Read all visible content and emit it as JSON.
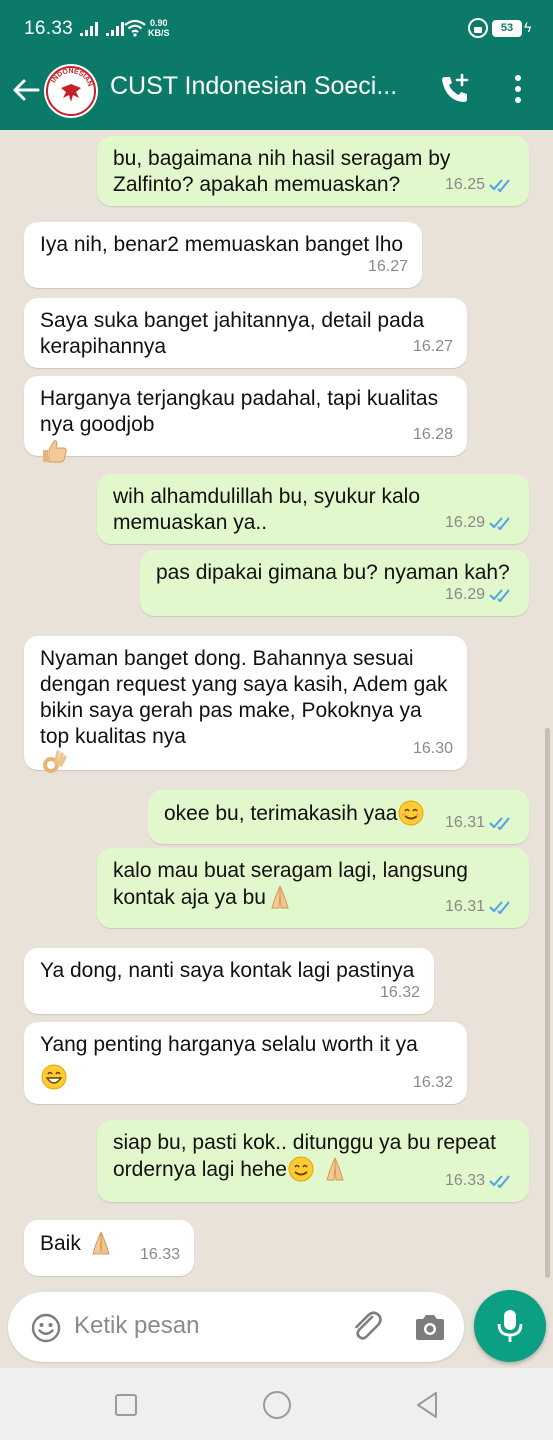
{
  "status_bar": {
    "time": "16.33",
    "net_speed_value": "0.90",
    "net_speed_unit": "KB/S",
    "battery": "53"
  },
  "header": {
    "avatar_text": "INDONESIAN",
    "title": "CUST Indonesian Soeci..."
  },
  "messages": [
    {
      "dir": "out",
      "text": "bu, bagaimana nih hasil seragam by\nZalfinto? apakah memuaskan?",
      "time": "16.25",
      "read": true
    },
    {
      "dir": "in",
      "text": "Iya nih, benar2 memuaskan banget lho",
      "time": "16.27"
    },
    {
      "dir": "in",
      "text": "Saya suka banget jahitannya, detail pada\nkerapihannya",
      "time": "16.27"
    },
    {
      "dir": "in",
      "text": "Harganya terjangkau padahal, tapi kualitas\nnya goodjob",
      "emoji": "thumbs-up",
      "time": "16.28"
    },
    {
      "dir": "out",
      "text": "wih alhamdulillah bu, syukur kalo\nmemuaskan ya..",
      "time": "16.29",
      "read": true
    },
    {
      "dir": "out",
      "text": "pas dipakai gimana bu? nyaman kah?",
      "time": "16.29",
      "read": true
    },
    {
      "dir": "in",
      "text": "Nyaman banget dong. Bahannya sesuai\ndengan request yang saya kasih, Adem gak\nbikin saya gerah pas make, Pokoknya ya\ntop kualitas nya",
      "emoji": "ok-hand",
      "time": "16.30"
    },
    {
      "dir": "out",
      "text": "okee bu, terimakasih yaa",
      "emoji": "smile",
      "time": "16.31",
      "read": true
    },
    {
      "dir": "out",
      "text": "kalo mau buat seragam lagi, langsung\nkontak aja ya bu",
      "emoji": "folded-hands",
      "time": "16.31",
      "read": true
    },
    {
      "dir": "in",
      "text": "Ya dong, nanti saya kontak lagi pastinya",
      "time": "16.32"
    },
    {
      "dir": "in",
      "text": "Yang penting harganya selalu worth it ya",
      "emoji": "grin",
      "time": "16.32"
    },
    {
      "dir": "out",
      "text": "siap bu, pasti kok.. ditunggu ya bu repeat\nordernya lagi hehe",
      "emoji": "smile-folded-hands",
      "time": "16.33",
      "read": true
    },
    {
      "dir": "in",
      "text": "Baik",
      "emoji": "folded-hands",
      "time": "16.33"
    }
  ],
  "composer": {
    "placeholder": "Ketik pesan"
  },
  "icons": {
    "back": "arrow-left-icon",
    "add_call": "phone-plus-icon",
    "menu": "more-vert-icon",
    "emoji": "emoji-icon",
    "attach": "paperclip-icon",
    "camera": "camera-icon",
    "mic": "mic-icon",
    "read_receipt": "double-check-icon"
  },
  "colors": {
    "header": "#0b7a68",
    "outgoing_bubble": "#e1f7cc",
    "incoming_bubble": "#ffffff",
    "chat_bg": "#e8e2d8",
    "read_tick": "#4fa3e0",
    "mic_button": "#0b9f84"
  }
}
